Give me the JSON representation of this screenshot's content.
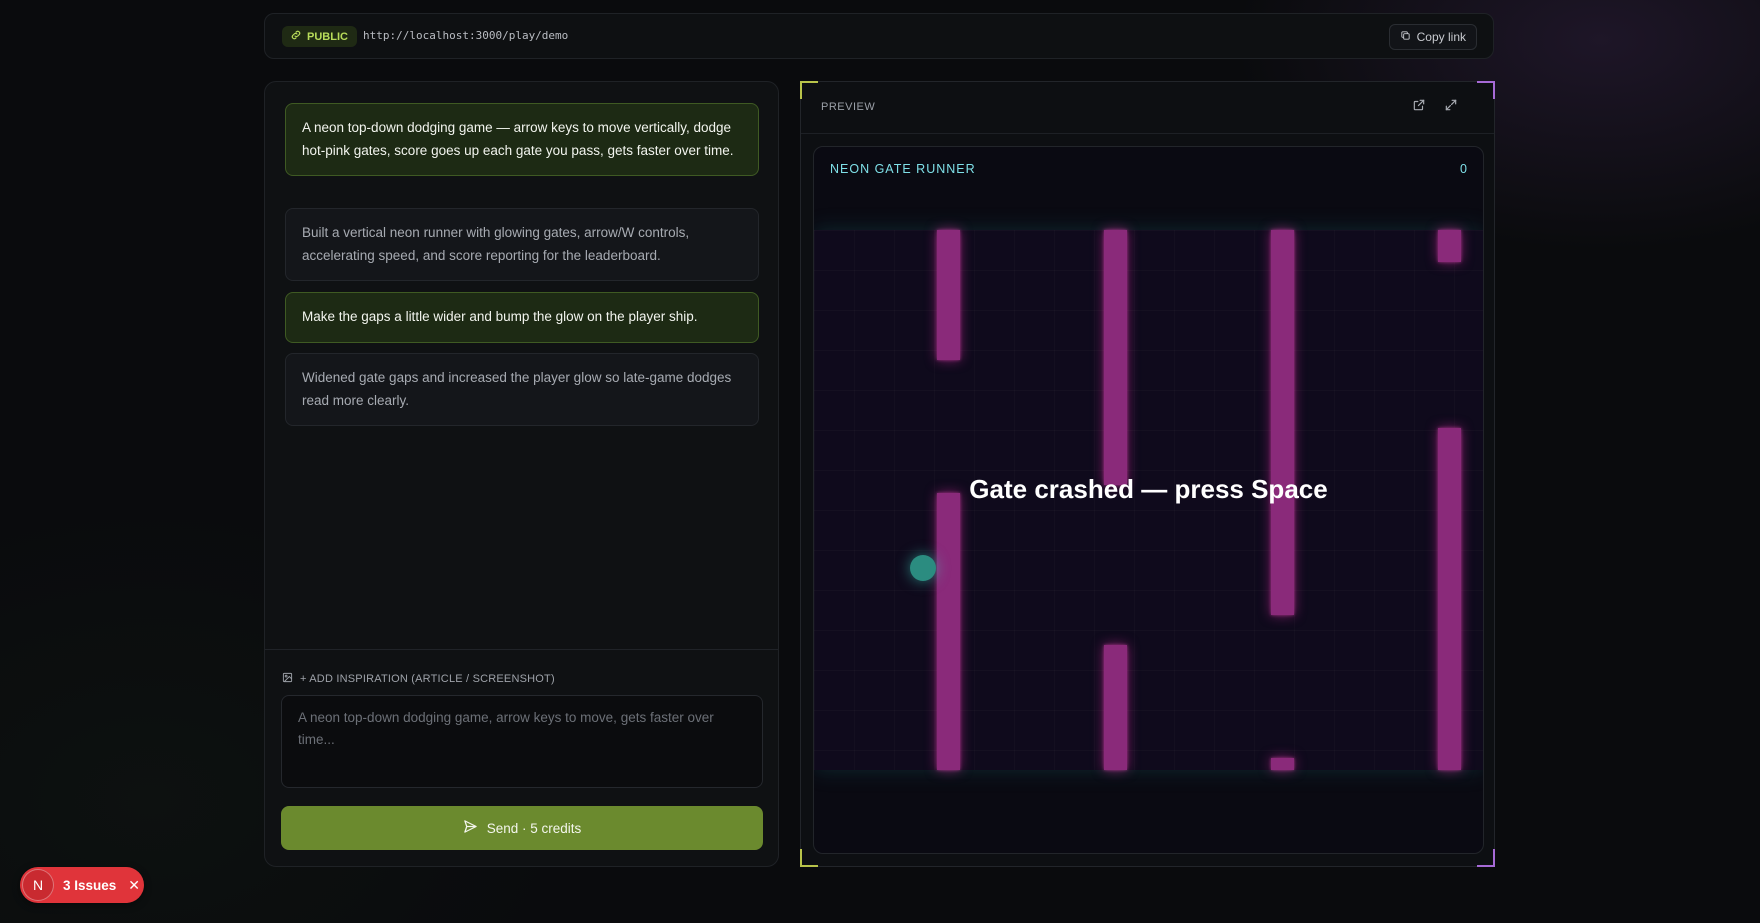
{
  "topbar": {
    "badge": "PUBLIC",
    "url": "http://localhost:3000/play/demo",
    "copy_label": "Copy link"
  },
  "chat": {
    "messages": [
      {
        "role": "user",
        "text": "A neon top-down dodging game — arrow keys to move vertically, dodge hot-pink gates, score goes up each gate you pass, gets faster over time."
      },
      {
        "role": "assistant",
        "text": "Built a vertical neon runner with glowing gates, arrow/W controls, accelerating speed, and score reporting for the leaderboard."
      },
      {
        "role": "user",
        "text": "Make the gaps a little wider and bump the glow on the player ship."
      },
      {
        "role": "assistant",
        "text": "Widened gate gaps and increased the player glow so late-game dodges read more clearly."
      }
    ],
    "inspiration_label": "+ ADD INSPIRATION (ARTICLE / SCREENSHOT)",
    "prompt_placeholder": "A neon top-down dodging game, arrow keys to move, gets faster over time...",
    "send_label": "Send · 5 credits"
  },
  "preview": {
    "label": "PREVIEW",
    "game_title": "NEON GATE RUNNER",
    "score": "0",
    "overlay": "Gate crashed — press Space",
    "colors": {
      "gate": "#8a2a7a",
      "ship": "#2b8c80",
      "title": "#7fe0e8"
    }
  },
  "issues": {
    "avatar": "N",
    "label": "3 Issues"
  }
}
